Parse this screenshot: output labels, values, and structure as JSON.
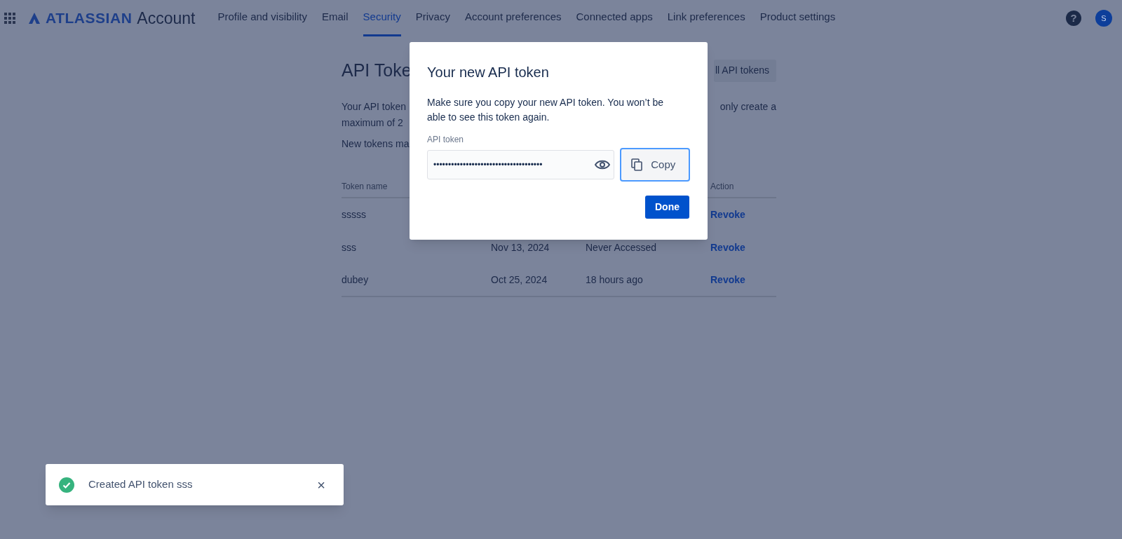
{
  "header": {
    "logo_brand": "ATLASSIAN",
    "logo_product": "Account",
    "nav": [
      {
        "label": "Profile and visibility",
        "selected": false
      },
      {
        "label": "Email",
        "selected": false
      },
      {
        "label": "Security",
        "selected": true
      },
      {
        "label": "Privacy",
        "selected": false
      },
      {
        "label": "Account preferences",
        "selected": false
      },
      {
        "label": "Connected apps",
        "selected": false
      },
      {
        "label": "Link preferences",
        "selected": false
      },
      {
        "label": "Product settings",
        "selected": false
      }
    ],
    "help": "?",
    "avatar": "S"
  },
  "page": {
    "title": "API Toke",
    "action_button": "ll API tokens",
    "description_left": [
      "Your API token",
      "maximum of 2"
    ],
    "description_right": "only create a",
    "note": "New tokens ma",
    "table": {
      "columns": {
        "name": "Token name",
        "action": "Action"
      },
      "rows": [
        {
          "name": "sssss",
          "created": "",
          "last_accessed": "",
          "action": "Revoke"
        },
        {
          "name": "sss",
          "created": "Nov 13, 2024",
          "last_accessed": "Never Accessed",
          "action": "Revoke"
        },
        {
          "name": "dubey",
          "created": "Oct 25, 2024",
          "last_accessed": "18 hours ago",
          "action": "Revoke"
        }
      ]
    }
  },
  "modal": {
    "title": "Your new API token",
    "body": "Make sure you copy your new API token. You won’t be able to see this token again.",
    "field_label": "API token",
    "value": "•••••••••••••••••••••••••••••••••••••",
    "copy": "Copy",
    "done": "Done"
  },
  "toast": {
    "message": "Created API token sss",
    "close": "×"
  }
}
